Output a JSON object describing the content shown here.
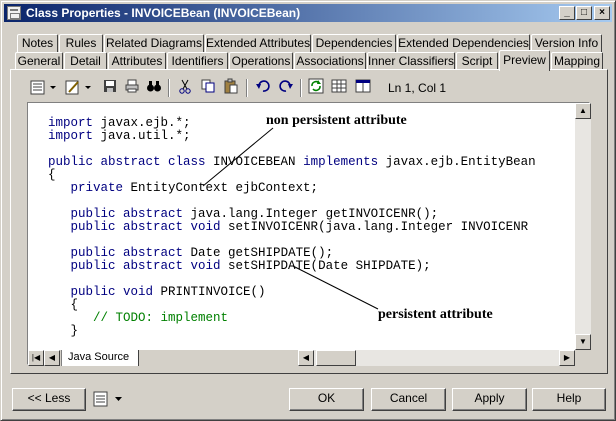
{
  "window": {
    "title": "Class Properties - INVOICEBean (INVOICEBean)",
    "controls": {
      "minimize": "_",
      "maximize": "□",
      "close": "×"
    }
  },
  "tabs": {
    "row1": [
      "Notes",
      "Rules",
      "Related Diagrams",
      "Extended Attributes",
      "Dependencies",
      "Extended Dependencies",
      "Version Info"
    ],
    "row2": [
      "General",
      "Detail",
      "Attributes",
      "Identifiers",
      "Operations",
      "Associations",
      "Inner Classifiers",
      "Script",
      "Preview",
      "Mapping"
    ],
    "active": "Preview"
  },
  "toolbar": {
    "cursor_position": "Ln 1, Col 1"
  },
  "editor": {
    "lines": [
      [
        {
          "t": "import",
          "k": true
        },
        {
          "t": " javax.ejb.*;"
        }
      ],
      [
        {
          "t": "import",
          "k": true
        },
        {
          "t": " java.util.*;"
        }
      ],
      [],
      [
        {
          "t": "public abstract class",
          "k": true
        },
        {
          "t": " INVOICEBEAN "
        },
        {
          "t": "implements",
          "k": true
        },
        {
          "t": " javax.ejb.EntityBean"
        }
      ],
      [
        {
          "t": "{"
        }
      ],
      [
        {
          "t": "   "
        },
        {
          "t": "private",
          "k": true
        },
        {
          "t": " EntityContext ejbContext;"
        }
      ],
      [],
      [
        {
          "t": "   "
        },
        {
          "t": "public abstract",
          "k": true
        },
        {
          "t": " java.lang.Integer getINVOICENR();"
        }
      ],
      [
        {
          "t": "   "
        },
        {
          "t": "public abstract void",
          "k": true
        },
        {
          "t": " setINVOICENR(java.lang.Integer INVOICENR"
        }
      ],
      [],
      [
        {
          "t": "   "
        },
        {
          "t": "public abstract",
          "k": true
        },
        {
          "t": " Date getSHIPDATE();"
        }
      ],
      [
        {
          "t": "   "
        },
        {
          "t": "public abstract void",
          "k": true
        },
        {
          "t": " setSHIPDATE(Date SHIPDATE);"
        }
      ],
      [],
      [
        {
          "t": "   "
        },
        {
          "t": "public void",
          "k": true
        },
        {
          "t": " PRINTINVOICE()"
        }
      ],
      [
        {
          "t": "   {"
        }
      ],
      [
        {
          "t": "      "
        },
        {
          "t": "// TODO: implement",
          "c": true
        }
      ],
      [
        {
          "t": "   }"
        }
      ]
    ],
    "source_tab": "Java Source"
  },
  "annotations": {
    "non_persistent": "non persistent attribute",
    "persistent": "persistent attribute"
  },
  "buttons": {
    "less": "<< Less",
    "ok": "OK",
    "cancel": "Cancel",
    "apply": "Apply",
    "help": "Help"
  }
}
